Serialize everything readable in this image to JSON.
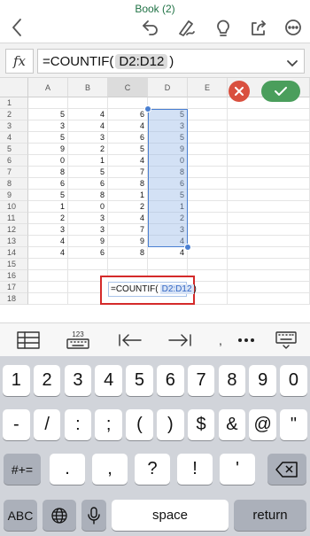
{
  "app": {
    "doc_title": "Book (2)"
  },
  "toolbar": {
    "back_icon": "chevron-left-icon",
    "undo_icon": "undo-icon",
    "draw_icon": "draw-icon",
    "search_icon": "lightbulb-icon",
    "share_icon": "share-icon",
    "more_icon": "ellipsis-icon"
  },
  "formula_bar": {
    "fx_label": "fx",
    "prefix": "=COUNTIF(",
    "range": "D2:D12",
    "suffix": ")"
  },
  "columns": [
    "A",
    "B",
    "C",
    "D",
    "E"
  ],
  "rows": [
    {
      "num": "1",
      "a": "",
      "b": "",
      "c": "",
      "d": ""
    },
    {
      "num": "2",
      "a": "5",
      "b": "4",
      "c": "6",
      "d": "5"
    },
    {
      "num": "3",
      "a": "3",
      "b": "4",
      "c": "4",
      "d": "3"
    },
    {
      "num": "4",
      "a": "5",
      "b": "3",
      "c": "6",
      "d": "5"
    },
    {
      "num": "5",
      "a": "9",
      "b": "2",
      "c": "5",
      "d": "9"
    },
    {
      "num": "6",
      "a": "0",
      "b": "1",
      "c": "4",
      "d": "0"
    },
    {
      "num": "7",
      "a": "8",
      "b": "5",
      "c": "7",
      "d": "8"
    },
    {
      "num": "8",
      "a": "6",
      "b": "6",
      "c": "8",
      "d": "6"
    },
    {
      "num": "9",
      "a": "5",
      "b": "8",
      "c": "1",
      "d": "5"
    },
    {
      "num": "10",
      "a": "1",
      "b": "0",
      "c": "2",
      "d": "1"
    },
    {
      "num": "11",
      "a": "2",
      "b": "3",
      "c": "4",
      "d": "2"
    },
    {
      "num": "12",
      "a": "3",
      "b": "3",
      "c": "7",
      "d": "3"
    },
    {
      "num": "13",
      "a": "4",
      "b": "9",
      "c": "9",
      "d": "4"
    },
    {
      "num": "14",
      "a": "4",
      "b": "6",
      "c": "8",
      "d": "4"
    },
    {
      "num": "15",
      "a": "",
      "b": "",
      "c": "",
      "d": ""
    },
    {
      "num": "16",
      "a": "",
      "b": "",
      "c": "",
      "d": ""
    },
    {
      "num": "17",
      "a": "",
      "b": "",
      "c": "",
      "d": ""
    },
    {
      "num": "18",
      "a": "",
      "b": "",
      "c": "",
      "d": ""
    }
  ],
  "edit_cell": {
    "prefix": "=COUNTIF(",
    "range": "D2:D12",
    "suffix": ")"
  },
  "accessory": {
    "numeric_label": "123"
  },
  "keyboard": {
    "row1": [
      "1",
      "2",
      "3",
      "4",
      "5",
      "6",
      "7",
      "8",
      "9",
      "0"
    ],
    "row2": [
      "-",
      "/",
      ":",
      ";",
      "(",
      ")",
      "$",
      "&",
      "@",
      "\""
    ],
    "row3": [
      ".",
      ",",
      "?",
      "!",
      "'"
    ],
    "symbols_key": "#+=",
    "abc_key": "ABC",
    "space_key": "space",
    "return_key": "return"
  },
  "colors": {
    "accent": "#217346",
    "selection": "#4a7fd1",
    "highlight_box": "#d42a2a",
    "ok": "#4a9e5c",
    "cancel": "#d9503f"
  }
}
